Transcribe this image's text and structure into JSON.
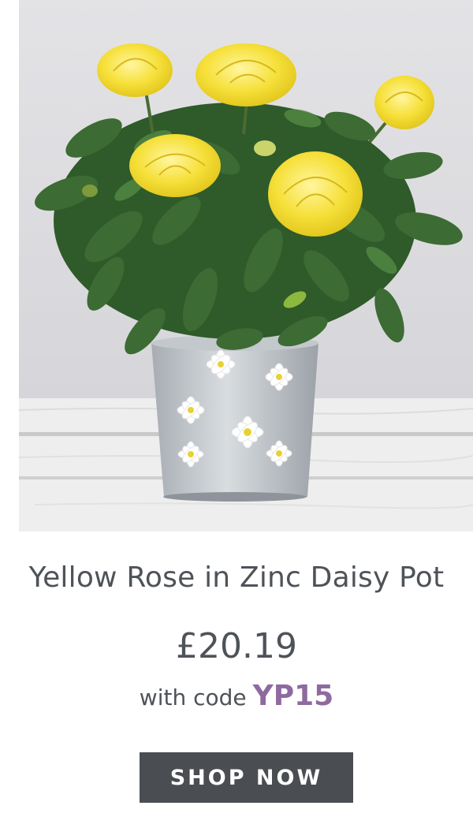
{
  "product": {
    "title": "Yellow Rose in Zinc Daisy Pot",
    "price": "£20.19",
    "code_prefix": "with code",
    "code": "YP15"
  },
  "cta": {
    "label": "SHOP NOW"
  },
  "colors": {
    "accent_code": "#8e6aa0",
    "button_bg": "#4a4d51",
    "text": "#4e5359"
  }
}
